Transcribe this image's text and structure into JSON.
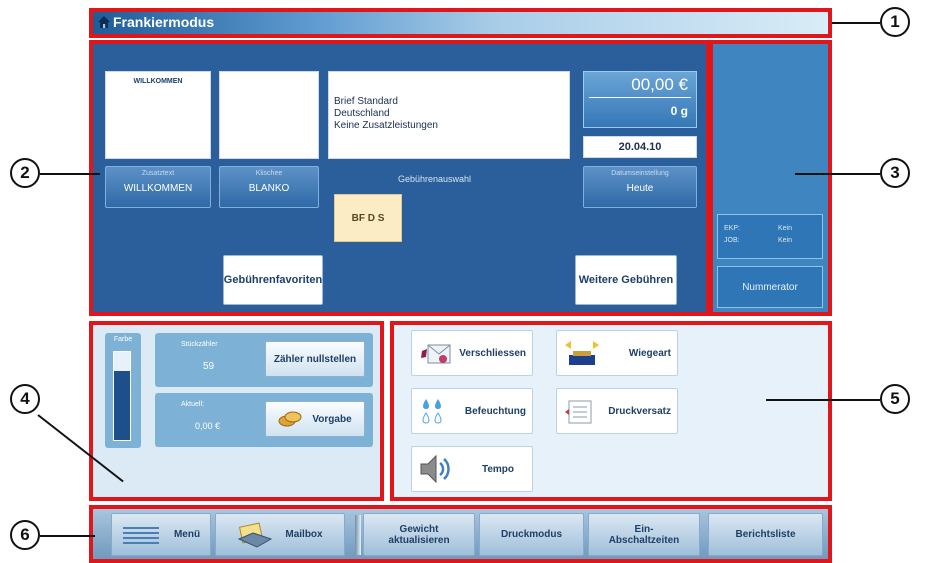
{
  "title_bar": {
    "title": "Frankiermodus",
    "icon": "home-icon"
  },
  "callouts": [
    "1",
    "2",
    "3",
    "4",
    "5",
    "6"
  ],
  "main": {
    "preview_text": "WILLKOMMEN",
    "service_lines": [
      "Brief Standard",
      "Deutschland",
      "Keine Zusatzleistungen"
    ],
    "amount": "00,00 €",
    "weight": "0 g",
    "date": "20.04.10",
    "zusatztext": {
      "label": "Zusatztext",
      "value": "WILLKOMMEN"
    },
    "klischee": {
      "label": "Klischee",
      "value": "BLANKO"
    },
    "gebuehrenauswahl_label": "Gebührenauswahl",
    "rate_button": "BF D S",
    "datumseinstellung": {
      "label": "Datumseinstellung",
      "value": "Heute"
    },
    "gebuehrenfavoriten": "Gebührenfavoriten",
    "weitere_gebuehren": "Weitere Gebühren"
  },
  "side": {
    "rows": [
      {
        "key": "EKP:",
        "value": "Kein"
      },
      {
        "key": "JOB:",
        "value": "Kein"
      }
    ],
    "nummerator": "Nummerator"
  },
  "counters": {
    "farbe_label": "Farbe",
    "ink_level": 0.78,
    "stueckzaehler": {
      "label": "Stückzähler",
      "value": "59"
    },
    "reset_button": "Zähler nullstellen",
    "aktuell": {
      "label": "Aktuell:",
      "value": "0,00 €"
    },
    "vorgabe_button": "Vorgabe"
  },
  "functions": {
    "tiles": [
      {
        "label": "Verschliessen",
        "icon": "envelope-seal-icon"
      },
      {
        "label": "Wiegeart",
        "icon": "scale-icon"
      },
      {
        "label": "Befeuchtung",
        "icon": "water-drops-icon"
      },
      {
        "label": "Druckversatz",
        "icon": "print-offset-icon"
      },
      {
        "label": "Tempo",
        "icon": "speaker-icon"
      }
    ]
  },
  "bottom_bar": {
    "menu": "Menü",
    "mailbox": "Mailbox",
    "gewicht": [
      "Gewicht",
      "aktualisieren"
    ],
    "druckmodus": "Druckmodus",
    "abschaltzeiten": [
      "Ein-",
      "Abschaltzeiten"
    ],
    "berichtsliste": "Berichtsliste"
  },
  "colors": {
    "frame": "#e0161b",
    "panel": "#2a5f9b",
    "accent": "#3f86c0"
  }
}
